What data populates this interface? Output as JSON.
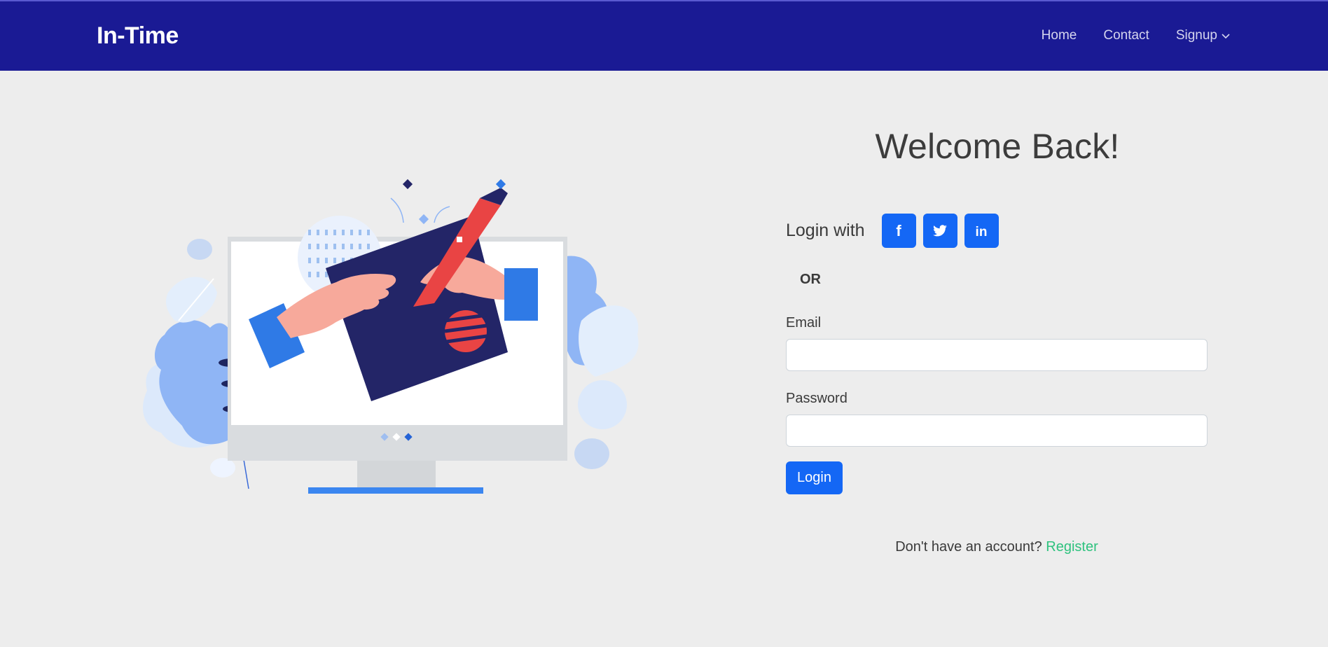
{
  "nav": {
    "brand": "In-Time",
    "links": [
      {
        "label": "Home"
      },
      {
        "label": "Contact"
      },
      {
        "label": "Signup"
      }
    ]
  },
  "login": {
    "title": "Welcome Back!",
    "login_with": "Login with",
    "social": [
      {
        "icon": "facebook-icon",
        "glyph": "f"
      },
      {
        "icon": "twitter-icon"
      },
      {
        "icon": "linkedin-icon",
        "glyph": "in"
      }
    ],
    "or": "OR",
    "email_label": "Email",
    "email_value": "",
    "password_label": "Password",
    "password_value": "",
    "submit_label": "Login",
    "no_account": "Don't have an account?",
    "register_label": "Register"
  },
  "colors": {
    "navbar": "#1a1a94",
    "accent": "#1467f5",
    "link_green": "#2ec27e",
    "background": "#ededed"
  }
}
